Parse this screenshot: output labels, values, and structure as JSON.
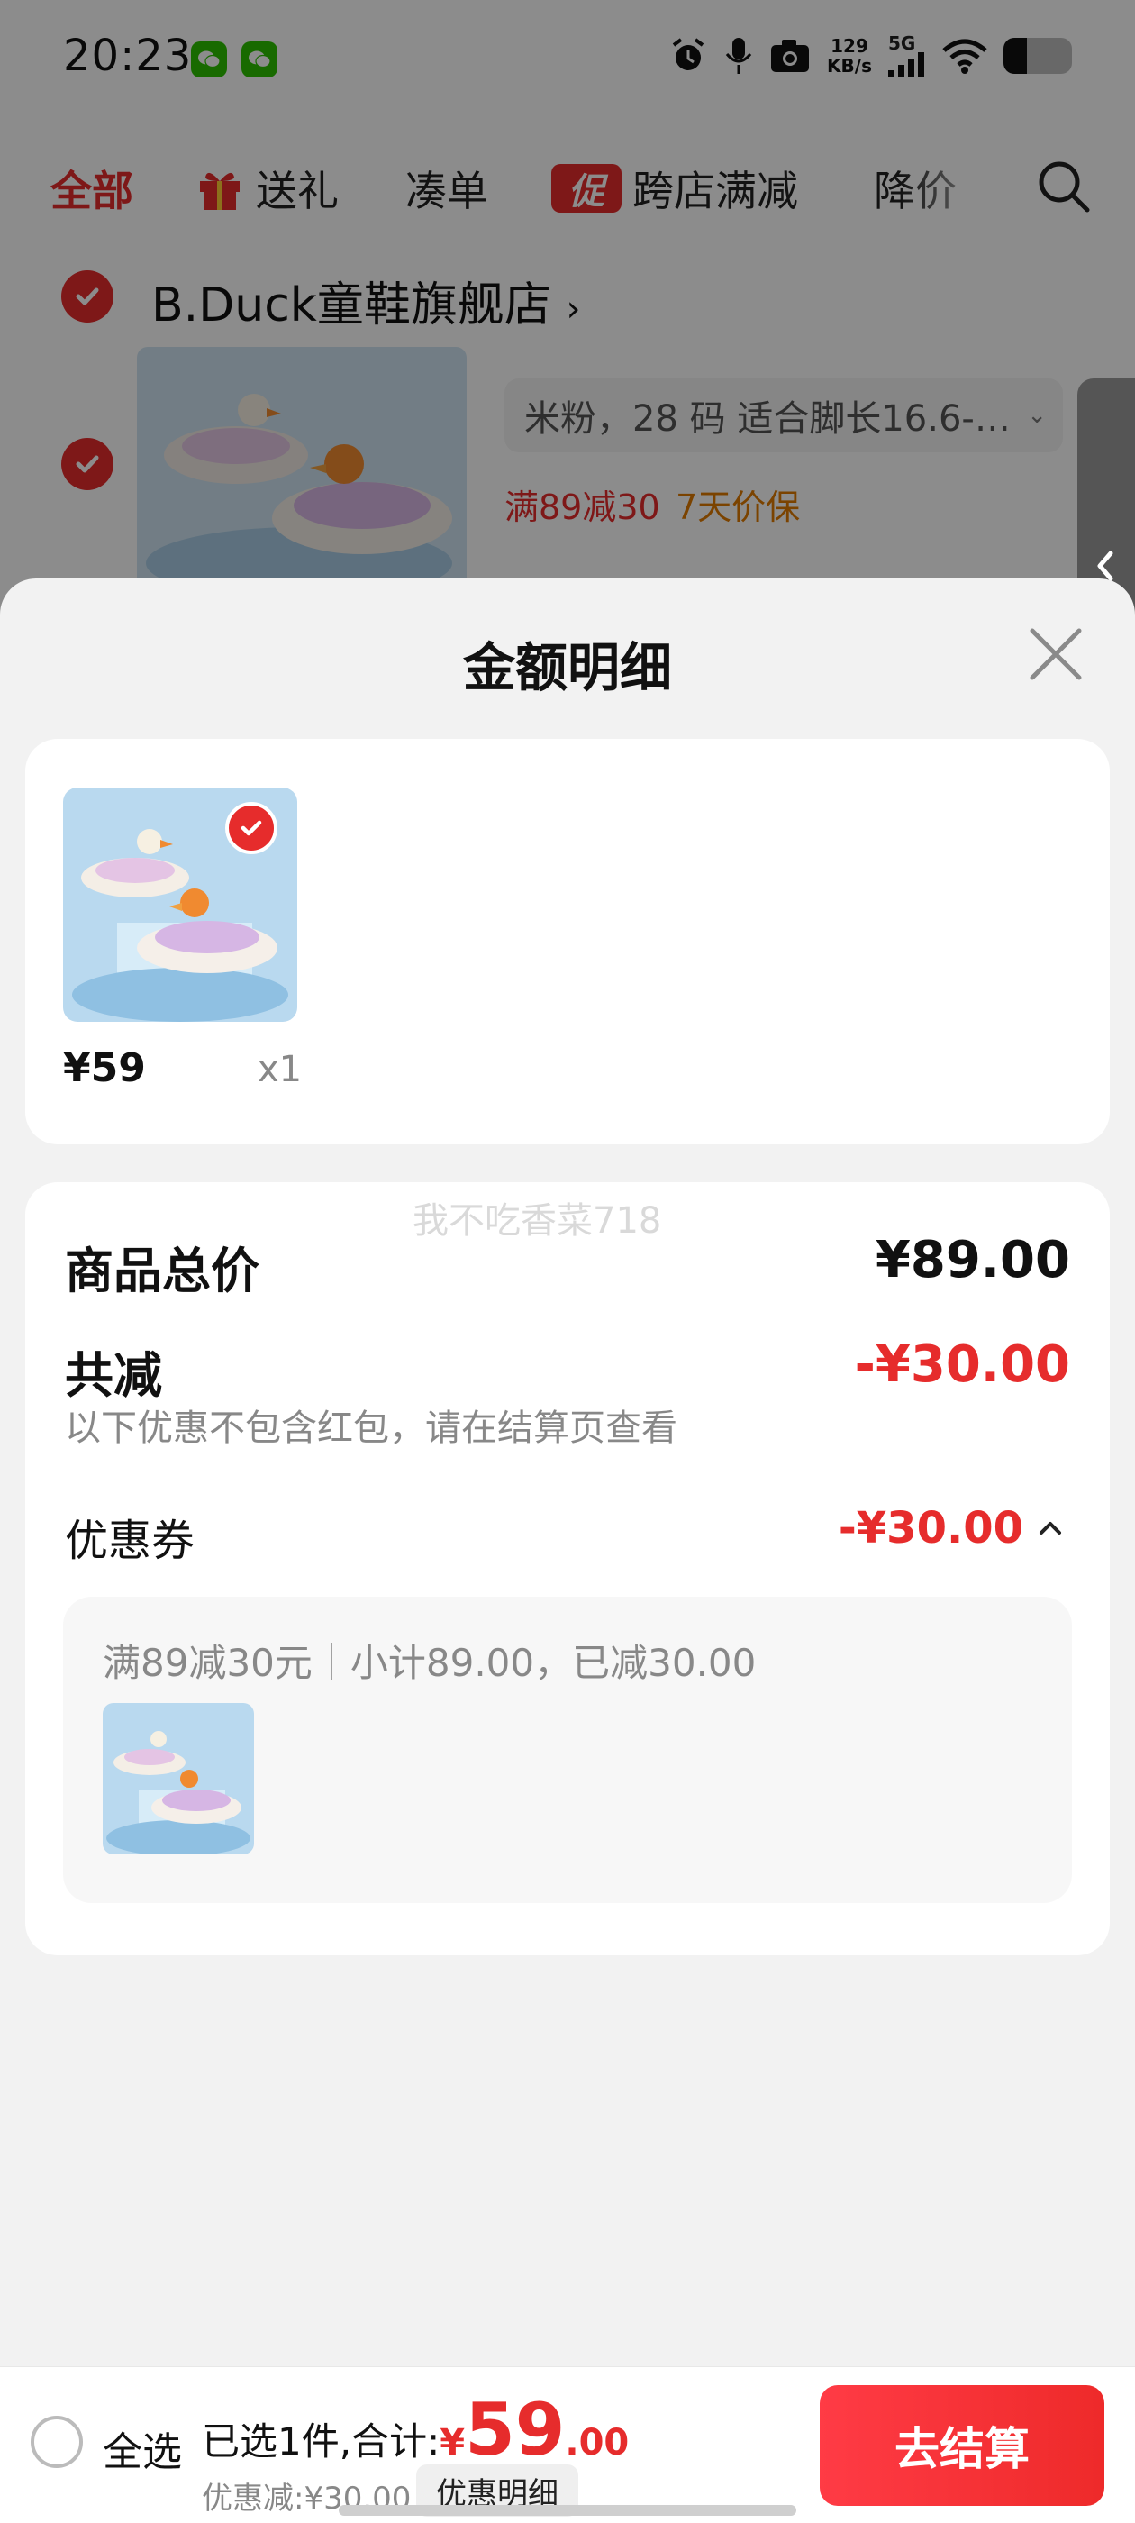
{
  "status_bar": {
    "time": "20:23",
    "net_speed_value": "129",
    "net_speed_unit": "KB/s",
    "network": "5G",
    "icons": [
      "wechat-icon",
      "wechat-icon",
      "alarm-icon",
      "mic-icon",
      "camera-icon",
      "signal-icon",
      "wifi-icon",
      "battery-icon"
    ]
  },
  "tabs": {
    "all": "全部",
    "gift": "送礼",
    "bundle": "凑单",
    "promo_badge": "促",
    "cross_store": "跨店满减",
    "price_drop": "降价"
  },
  "shop": {
    "name": "B.Duck童鞋旗舰店",
    "chevron": "›",
    "sku": "米粉，28 码 适合脚长16.6-…",
    "promo_tag": "满89减30",
    "guarantee_tag": "7天价保"
  },
  "sheet": {
    "title": "金额明细"
  },
  "goods": {
    "price": "¥59",
    "qty": "x1"
  },
  "details": {
    "watermark": "我不吃香菜718",
    "total_label": "商品总价",
    "total_value": "¥89.00",
    "reduce_label": "共减",
    "reduce_value": "-¥30.00",
    "reduce_note": "以下优惠不包含红包，请在结算页查看",
    "coupon_label": "优惠券",
    "coupon_value": "-¥30.00",
    "coupon_desc": "满89减30元｜小计89.00，已减30.00"
  },
  "bottom": {
    "select_all": "全选",
    "summary_prefix": "已选1件,合计:",
    "yen": "¥",
    "amount_int": "59",
    "amount_dec": ".00",
    "discount": "优惠减:¥30.00",
    "detail_button": "优惠明细",
    "checkout": "去结算"
  },
  "colors": {
    "accent_red": "#e62c2c",
    "orange": "#e07a00",
    "sheet_bg": "#f2f2f2"
  }
}
